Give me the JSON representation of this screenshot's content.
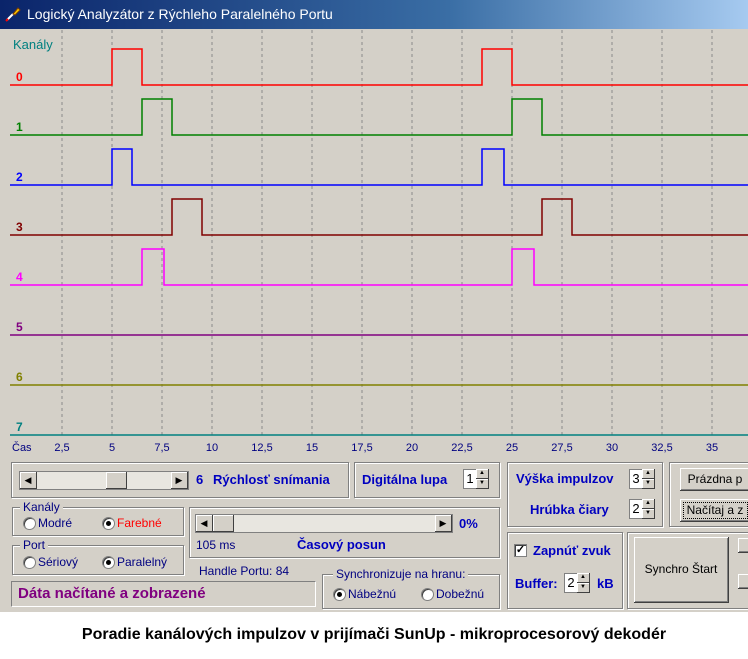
{
  "window": {
    "title": "Logický Analyzátor z Rýchleho Paralelného Portu"
  },
  "scope": {
    "header": "Kanály",
    "channels": [
      {
        "label": "0",
        "color": "#ff0000",
        "pulses": [
          [
            5,
            6.5
          ],
          [
            23.5,
            25
          ]
        ]
      },
      {
        "label": "1",
        "color": "#008000",
        "pulses": [
          [
            6.5,
            8
          ],
          [
            25,
            26.5
          ]
        ]
      },
      {
        "label": "2",
        "color": "#0000ff",
        "pulses": [
          [
            5,
            6
          ],
          [
            23.5,
            24.6
          ]
        ]
      },
      {
        "label": "3",
        "color": "#800000",
        "pulses": [
          [
            8,
            9.5
          ],
          [
            26.5,
            28
          ]
        ]
      },
      {
        "label": "4",
        "color": "#ff00ff",
        "pulses": [
          [
            6.5,
            7.6
          ],
          [
            25,
            26.1
          ]
        ]
      },
      {
        "label": "5",
        "color": "#800080",
        "pulses": []
      },
      {
        "label": "6",
        "color": "#808000",
        "pulses": []
      },
      {
        "label": "7",
        "color": "#008080",
        "pulses": []
      }
    ],
    "time_label": "Čas",
    "ticks": [
      "2,5",
      "5",
      "7,5",
      "10",
      "12,5",
      "15",
      "17,5",
      "20",
      "22,5",
      "25",
      "27,5",
      "30",
      "32,5",
      "35"
    ]
  },
  "controls": {
    "speed_value": "6",
    "speed_label": "Rýchlosť snímania",
    "zoom_label": "Digitálna lupa",
    "zoom_value": "1",
    "pulse_height_label": "Výška impulzov",
    "pulse_height_value": "3",
    "line_width_label": "Hrúbka čiary",
    "line_width_value": "2",
    "btn_empty": "Prázdna p",
    "btn_load": "Načítaj a z",
    "channels_group": "Kanály",
    "ch_opt1": "Modré",
    "ch_opt2": "Farebné",
    "offset_percent": "0%",
    "offset_ms": "105 ms",
    "offset_label": "Časový posun",
    "port_group": "Port",
    "port_opt1": "Sériový",
    "port_opt2": "Paralelný",
    "handle_label": "Handle Portu: 84",
    "status": "Dáta načítané a zobrazené",
    "sync_group": "Synchronizuje na hranu:",
    "sync_opt1": "Nábežnú",
    "sync_opt2": "Dobežnú",
    "sound_label": "Zapnúť zvuk",
    "buffer_label": "Buffer:",
    "buffer_value": "2",
    "buffer_unit": "kB",
    "synchro_btn": "Synchro Štart"
  },
  "caption": "Poradie kanálových impulzov v prijímači SunUp - mikroprocesorový dekodér"
}
